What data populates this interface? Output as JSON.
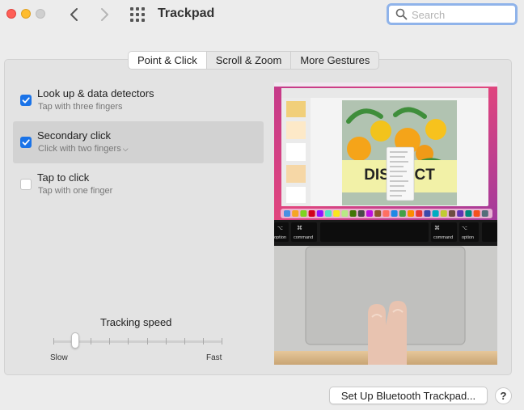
{
  "window": {
    "title": "Trackpad",
    "colors": {
      "close": "#fe5f57",
      "minimize": "#febc2e",
      "zoom": "#cfcfcf",
      "accent": "#1a73e8"
    }
  },
  "toolbar": {
    "back_icon": "chevron-left-icon",
    "forward_icon": "chevron-right-icon",
    "grid_icon": "show-all-grid-icon"
  },
  "search": {
    "placeholder": "Search",
    "value": ""
  },
  "tabs": [
    {
      "label": "Point & Click",
      "active": true
    },
    {
      "label": "Scroll & Zoom",
      "active": false
    },
    {
      "label": "More Gestures",
      "active": false
    }
  ],
  "options": [
    {
      "label": "Look up & data detectors",
      "sub": "Tap with three fingers",
      "checked": true,
      "selected": false
    },
    {
      "label": "Secondary click",
      "sub": "Click with two fingers",
      "checked": true,
      "selected": true,
      "has_menu": true
    },
    {
      "label": "Tap to click",
      "sub": "Tap with one finger",
      "checked": false,
      "selected": false
    }
  ],
  "tracking_speed": {
    "label": "Tracking speed",
    "min_label": "Slow",
    "max_label": "Fast",
    "ticks": 10,
    "value": 0.13
  },
  "preview": {
    "poster_title": "DISTINCT",
    "keys": [
      "⌥",
      "⌘",
      "⌘",
      "⌥"
    ],
    "key_labels": [
      "option",
      "command",
      "command",
      "option"
    ]
  },
  "footer": {
    "bluetooth_button": "Set Up Bluetooth Trackpad...",
    "help_button": "?"
  }
}
